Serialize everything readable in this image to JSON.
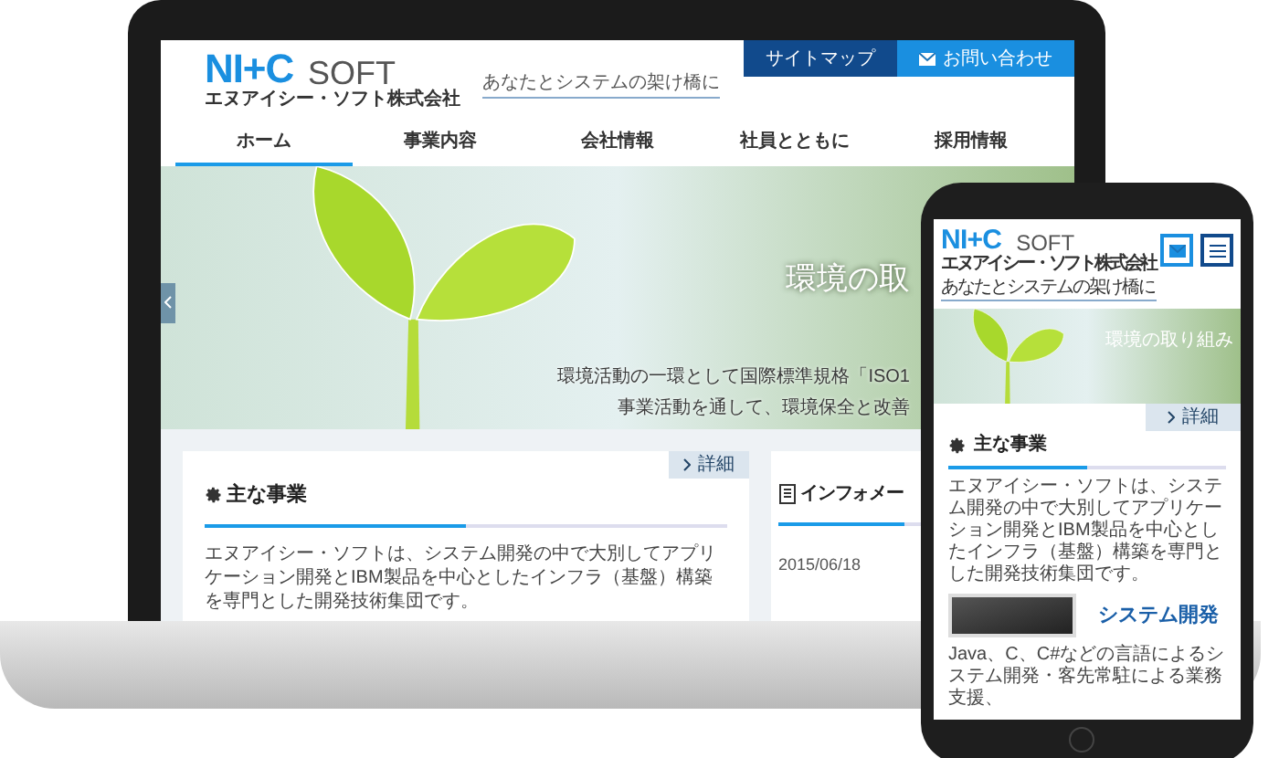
{
  "laptop": {
    "logo": {
      "mark": "NI+C",
      "word": "SOFT",
      "company": "エヌアイシー・ソフト株式会社"
    },
    "tagline": "あなたとシステムの架け橋に",
    "top_links": [
      {
        "label": "サイトマップ",
        "kind": "sitemap"
      },
      {
        "label": "お問い合わせ",
        "kind": "contact"
      }
    ],
    "nav": [
      {
        "label": "ホーム",
        "selected": true
      },
      {
        "label": "事業内容",
        "selected": false
      },
      {
        "label": "会社情報",
        "selected": false
      },
      {
        "label": "社員とともに",
        "selected": false
      },
      {
        "label": "採用情報",
        "selected": false
      }
    ],
    "hero": {
      "title": "環境の取",
      "lines": [
        "環境活動の一環として国際標準規格「ISO1",
        "事業活動を通して、環境保全と改善"
      ]
    },
    "cards": [
      {
        "kind": "business",
        "heading": "主な事業",
        "more": "詳細",
        "text": "エヌアイシー・ソフトは、システム開発の中で大別してアプリケーション開発とIBM製品を中心としたインフラ（基盤）構築を専門とした開発技術集団です。"
      },
      {
        "kind": "info",
        "heading": "インフォメー",
        "date": "2015/06/18"
      }
    ]
  },
  "phone": {
    "logo": {
      "mark": "NI+C",
      "word": "SOFT",
      "company": "エヌアイシー・ソフト株式会社"
    },
    "tagline": "あなたとシステムの架け橋に",
    "hero": {
      "title": "環境の取り組み"
    },
    "more": "詳細",
    "heading": "主な事業",
    "text": "エヌアイシー・ソフトは、システム開発の中で大別してアプリケーション開発とIBM製品を中心としたインフラ（基盤）構築を専門とした開発技術集団です。",
    "feature": "システム開発",
    "text2": "Java、C、C#などの言語によるシステム開発・客先常駐による業務支援、"
  }
}
